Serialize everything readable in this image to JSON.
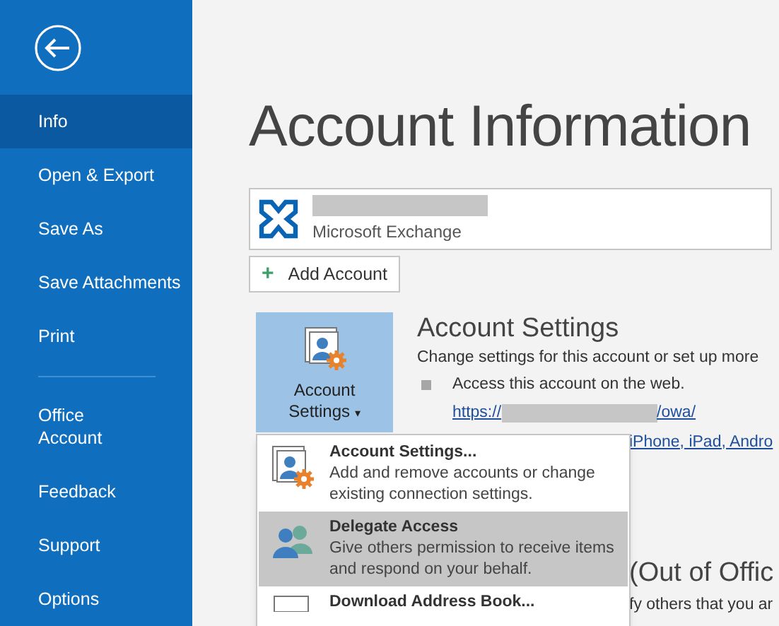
{
  "sidebar": {
    "items": [
      {
        "label": "Info",
        "selected": true
      },
      {
        "label": "Open & Export",
        "selected": false
      },
      {
        "label": "Save As",
        "selected": false
      },
      {
        "label": "Save Attachments",
        "selected": false
      },
      {
        "label": "Print",
        "selected": false
      },
      {
        "kind": "divider"
      },
      {
        "label": "Office\nAccount",
        "selected": false
      },
      {
        "label": "Feedback",
        "selected": false
      },
      {
        "label": "Support",
        "selected": false
      },
      {
        "label": "Options",
        "selected": false
      }
    ]
  },
  "title": "Account Information",
  "account": {
    "type": "Microsoft Exchange"
  },
  "add_account_button": {
    "icon": "+",
    "label": "Add Account"
  },
  "account_settings_button": {
    "label_line_1": "Account",
    "label_line_2": "Settings",
    "caret": "▾"
  },
  "account_settings": {
    "heading": "Account Settings",
    "description": "Change settings for this account or set up more",
    "bullet": "Access this account on the web.",
    "link_start": "https://",
    "link_end": "/owa/",
    "link_2": "iPhone, iPad, Andro"
  },
  "out_of_office": {
    "heading": "(Out of Offic",
    "description": "fy others that you ar"
  },
  "menu": {
    "items": [
      {
        "kind": "settings",
        "title": "Account Settings...",
        "description": "Add and remove accounts or change existing connection settings.",
        "selected": false
      },
      {
        "kind": "delegate",
        "title": "Delegate Access",
        "description": "Give others permission to receive items and respond on your behalf.",
        "selected": true
      },
      {
        "kind": "addressbook",
        "title": "Download Address Book...",
        "selected": false
      }
    ]
  }
}
